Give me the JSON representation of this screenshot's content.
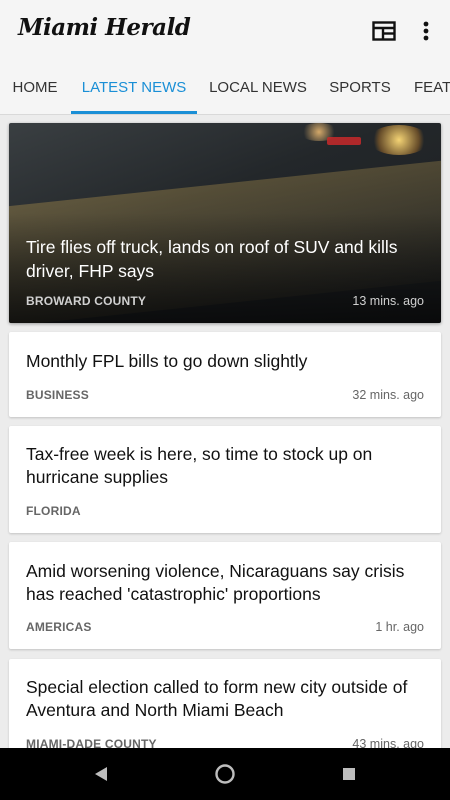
{
  "app": {
    "title": "Miami Herald"
  },
  "toolbar": {
    "layout_icon": "layout-icon",
    "menu_icon": "more-vert-icon"
  },
  "tabs": [
    {
      "label": "HOME"
    },
    {
      "label": "LATEST NEWS",
      "active": true
    },
    {
      "label": "LOCAL NEWS"
    },
    {
      "label": "SPORTS"
    },
    {
      "label": "FEAT"
    }
  ],
  "articles": [
    {
      "title": "Tire flies off truck, lands on roof of SUV and kills driver, FHP says",
      "section": "BROWARD COUNTY",
      "time": "13 mins. ago",
      "featured": true
    },
    {
      "title": "Monthly FPL bills to go down slightly",
      "section": "BUSINESS",
      "time": "32 mins. ago"
    },
    {
      "title": "Tax-free week is here, so time to stock up on hurricane supplies",
      "section": "FLORIDA",
      "time": ""
    },
    {
      "title": "Amid worsening violence, Nicaraguans say crisis has reached 'catastrophic' proportions",
      "section": "AMERICAS",
      "time": "1 hr. ago"
    },
    {
      "title": "Special election called to form new city outside of Aventura and North Miami Beach",
      "section": "MIAMI-DADE COUNTY",
      "time": "43 mins. ago"
    }
  ],
  "system_nav": {
    "back_icon": "back-icon",
    "home_icon": "home-icon",
    "recents_icon": "recents-icon"
  },
  "colors": {
    "accent": "#1a8fd6",
    "appbar": "#f5f5f5",
    "background": "#ececec"
  }
}
